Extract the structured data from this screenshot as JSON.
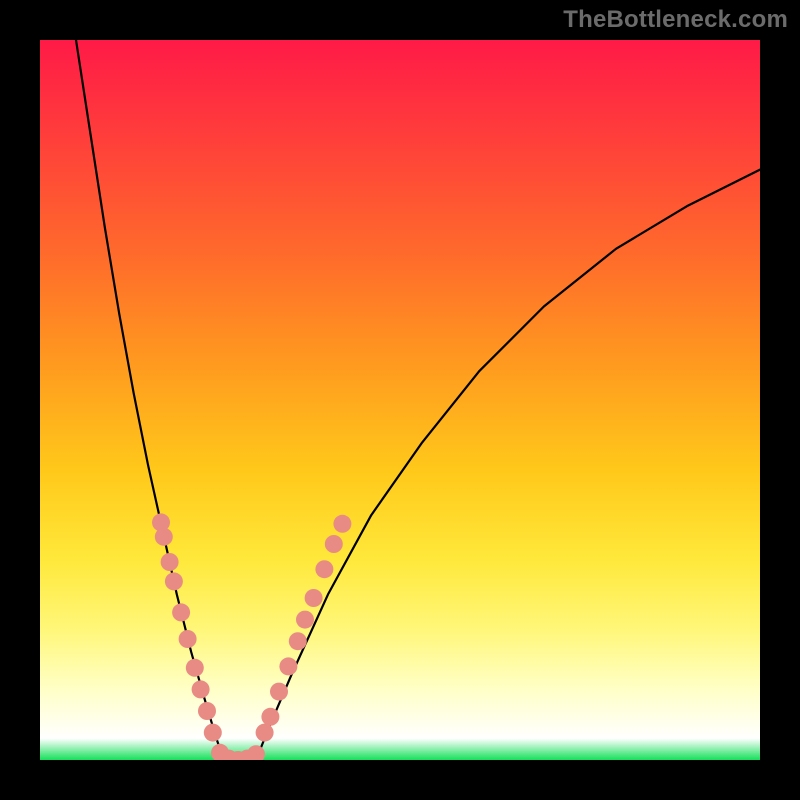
{
  "watermark": "TheBottleneck.com",
  "chart_data": {
    "type": "line",
    "title": "",
    "xlabel": "",
    "ylabel": "",
    "xlim": [
      0,
      1
    ],
    "ylim": [
      0,
      1
    ],
    "grid": false,
    "legend": false,
    "notes": "Axes are unlabeled; values are normalized 0–1 estimated from pixel positions. Background gradient encodes magnitude (red high → green low). Curve resembles a bottleneck/V with minimum near x≈0.26. Salmon dot clusters mark segments on both branches near the bottom.",
    "gradient_stops": [
      {
        "pos": 0.0,
        "color": "#ff1a47"
      },
      {
        "pos": 0.12,
        "color": "#ff3a3c"
      },
      {
        "pos": 0.3,
        "color": "#ff6b2b"
      },
      {
        "pos": 0.45,
        "color": "#ff9a1f"
      },
      {
        "pos": 0.6,
        "color": "#ffc91a"
      },
      {
        "pos": 0.72,
        "color": "#ffe83a"
      },
      {
        "pos": 0.82,
        "color": "#fff77a"
      },
      {
        "pos": 0.9,
        "color": "#ffffc5"
      },
      {
        "pos": 0.97,
        "color": "#ffffff"
      },
      {
        "pos": 1.0,
        "color": "#16e05a"
      }
    ],
    "series": [
      {
        "name": "left-branch",
        "x": [
          0.05,
          0.07,
          0.09,
          0.11,
          0.13,
          0.15,
          0.17,
          0.19,
          0.21,
          0.23,
          0.245,
          0.255
        ],
        "y": [
          1.0,
          0.87,
          0.74,
          0.62,
          0.51,
          0.41,
          0.32,
          0.23,
          0.15,
          0.08,
          0.03,
          0.0
        ]
      },
      {
        "name": "flat-min",
        "x": [
          0.255,
          0.27,
          0.285,
          0.3
        ],
        "y": [
          0.0,
          0.0,
          0.0,
          0.0
        ]
      },
      {
        "name": "right-branch",
        "x": [
          0.3,
          0.32,
          0.35,
          0.4,
          0.46,
          0.53,
          0.61,
          0.7,
          0.8,
          0.9,
          1.0
        ],
        "y": [
          0.0,
          0.05,
          0.12,
          0.23,
          0.34,
          0.44,
          0.54,
          0.63,
          0.71,
          0.77,
          0.82
        ]
      }
    ],
    "marker_clusters": [
      {
        "name": "left-dots",
        "color": "#e98b85",
        "points": [
          {
            "x": 0.168,
            "y": 0.33
          },
          {
            "x": 0.172,
            "y": 0.31
          },
          {
            "x": 0.18,
            "y": 0.275
          },
          {
            "x": 0.186,
            "y": 0.248
          },
          {
            "x": 0.196,
            "y": 0.205
          },
          {
            "x": 0.205,
            "y": 0.168
          },
          {
            "x": 0.215,
            "y": 0.128
          },
          {
            "x": 0.223,
            "y": 0.098
          },
          {
            "x": 0.232,
            "y": 0.068
          },
          {
            "x": 0.24,
            "y": 0.038
          }
        ]
      },
      {
        "name": "bottom-dots",
        "color": "#e98b85",
        "points": [
          {
            "x": 0.25,
            "y": 0.01
          },
          {
            "x": 0.262,
            "y": 0.002
          },
          {
            "x": 0.275,
            "y": 0.0
          },
          {
            "x": 0.288,
            "y": 0.002
          },
          {
            "x": 0.3,
            "y": 0.008
          }
        ]
      },
      {
        "name": "right-dots",
        "color": "#e98b85",
        "points": [
          {
            "x": 0.312,
            "y": 0.038
          },
          {
            "x": 0.32,
            "y": 0.06
          },
          {
            "x": 0.332,
            "y": 0.095
          },
          {
            "x": 0.345,
            "y": 0.13
          },
          {
            "x": 0.358,
            "y": 0.165
          },
          {
            "x": 0.368,
            "y": 0.195
          },
          {
            "x": 0.38,
            "y": 0.225
          },
          {
            "x": 0.395,
            "y": 0.265
          },
          {
            "x": 0.408,
            "y": 0.3
          },
          {
            "x": 0.42,
            "y": 0.328
          }
        ]
      }
    ]
  }
}
